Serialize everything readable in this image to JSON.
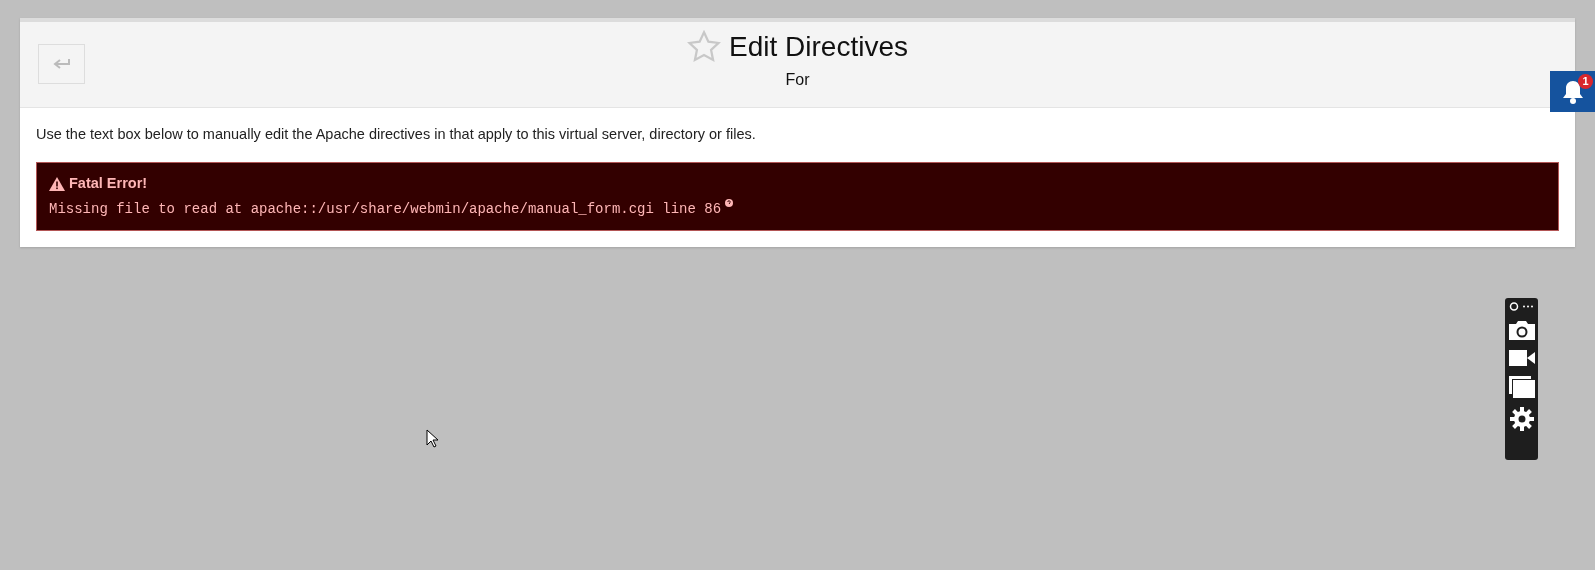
{
  "header": {
    "title": "Edit Directives",
    "subtitle": "For",
    "favorite": false
  },
  "description": "Use the text box below to manually edit the Apache directives in that apply to this virtual server, directory or files.",
  "error": {
    "title": "Fatal Error!",
    "message": "Missing file to read at apache::/usr/share/webmin/apache/manual_form.cgi line 86"
  },
  "notifications": {
    "count": "1"
  }
}
